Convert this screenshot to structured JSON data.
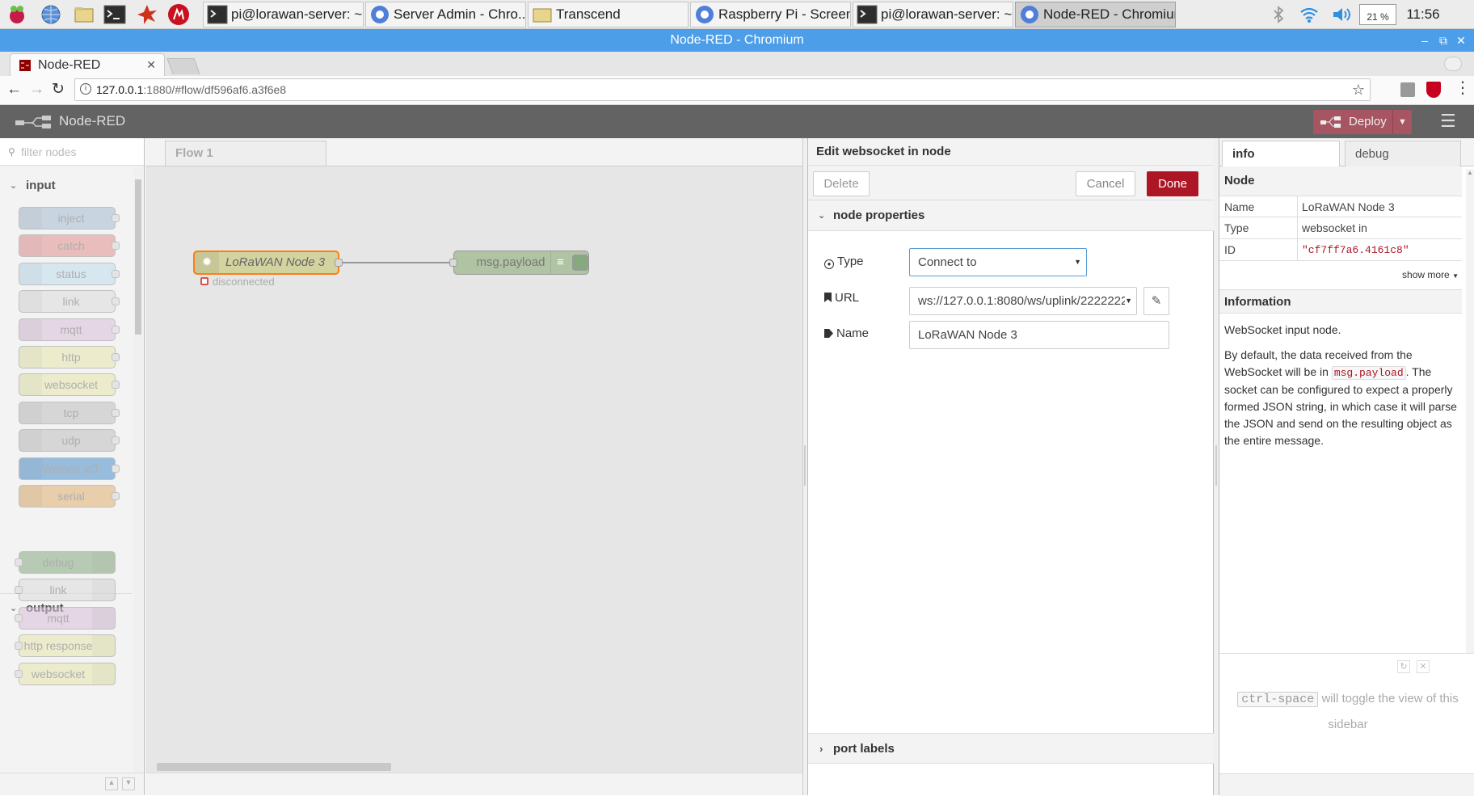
{
  "taskbar": {
    "tasks": [
      {
        "label": "pi@lorawan-server: ~",
        "icon": "terminal-icon"
      },
      {
        "label": "Server Admin - Chro...",
        "icon": "chromium-icon"
      },
      {
        "label": "Transcend",
        "icon": "folder-icon"
      },
      {
        "label": "Raspberry Pi - Screen...",
        "icon": "chromium-icon"
      },
      {
        "label": "pi@lorawan-server: ~",
        "icon": "terminal-icon"
      },
      {
        "label": "Node-RED - Chromium",
        "icon": "chromium-icon"
      }
    ],
    "cpu": "21 %",
    "clock": "11:56"
  },
  "window": {
    "title": "Node-RED - Chromium"
  },
  "browser": {
    "tab_title": "Node-RED",
    "url_host": "127.0.0.1",
    "url_rest": ":1880/#flow/df596af6.a3f6e8"
  },
  "header": {
    "app_name": "Node-RED",
    "deploy_label": "Deploy"
  },
  "palette": {
    "filter_placeholder": "filter nodes",
    "categories": [
      {
        "name": "input",
        "nodes": [
          {
            "label": "inject",
            "color": "#a6bbcf"
          },
          {
            "label": "catch",
            "color": "#e49191"
          },
          {
            "label": "status",
            "color": "#c0deed"
          },
          {
            "label": "link",
            "color": "#dddddd"
          },
          {
            "label": "mqtt",
            "color": "#d8bfd8"
          },
          {
            "label": "http",
            "color": "#e7e7ae"
          },
          {
            "label": "websocket",
            "color": "#e7e7ae"
          },
          {
            "label": "tcp",
            "color": "#c0c0c0"
          },
          {
            "label": "udp",
            "color": "#c0c0c0"
          },
          {
            "label": "Watson IoT",
            "color": "#4e90c9"
          },
          {
            "label": "serial",
            "color": "#e0b070"
          }
        ]
      },
      {
        "name": "output",
        "nodes": [
          {
            "label": "debug",
            "color": "#87a980"
          },
          {
            "label": "link",
            "color": "#dddddd"
          },
          {
            "label": "mqtt",
            "color": "#d8bfd8"
          },
          {
            "label": "http response",
            "color": "#e7e7ae"
          },
          {
            "label": "websocket",
            "color": "#e7e7ae"
          }
        ]
      }
    ]
  },
  "workspace": {
    "flow_tab": "Flow 1",
    "nodes": [
      {
        "label": "LoRaWAN Node 3",
        "status": "disconnected"
      },
      {
        "label": "msg.payload"
      }
    ]
  },
  "editor": {
    "title": "Edit websocket in node",
    "delete_label": "Delete",
    "cancel_label": "Cancel",
    "done_label": "Done",
    "section_props": "node properties",
    "type_label": "Type",
    "type_value": "Connect to",
    "url_label": "URL",
    "url_value": "ws://127.0.0.1:8080/ws/uplink/2222222",
    "name_label": "Name",
    "name_value": "LoRaWAN Node 3",
    "section_ports": "port labels"
  },
  "sidebar": {
    "tab_info": "info",
    "tab_debug": "debug",
    "node_header": "Node",
    "rows": [
      {
        "key": "Name",
        "value": "LoRaWAN Node 3"
      },
      {
        "key": "Type",
        "value": "websocket in"
      },
      {
        "key": "ID",
        "value": "\"cf7ff7a6.4161c8\""
      }
    ],
    "show_more": "show more",
    "info_header": "Information",
    "info_p1": "WebSocket input node.",
    "info_p2_a": "By default, the data received from the WebSocket will be in ",
    "info_p2_code": "msg.payload",
    "info_p2_b": ". The socket can be configured to expect a properly formed JSON string, in which case it will parse the JSON and send on the resulting object as the entire message.",
    "tip_key": "ctrl-space",
    "tip_text": " will toggle the view of this sidebar"
  },
  "colors": {
    "accent": "#ad1625",
    "deploy": "#a75562",
    "titlebar": "#4d9ee8"
  }
}
